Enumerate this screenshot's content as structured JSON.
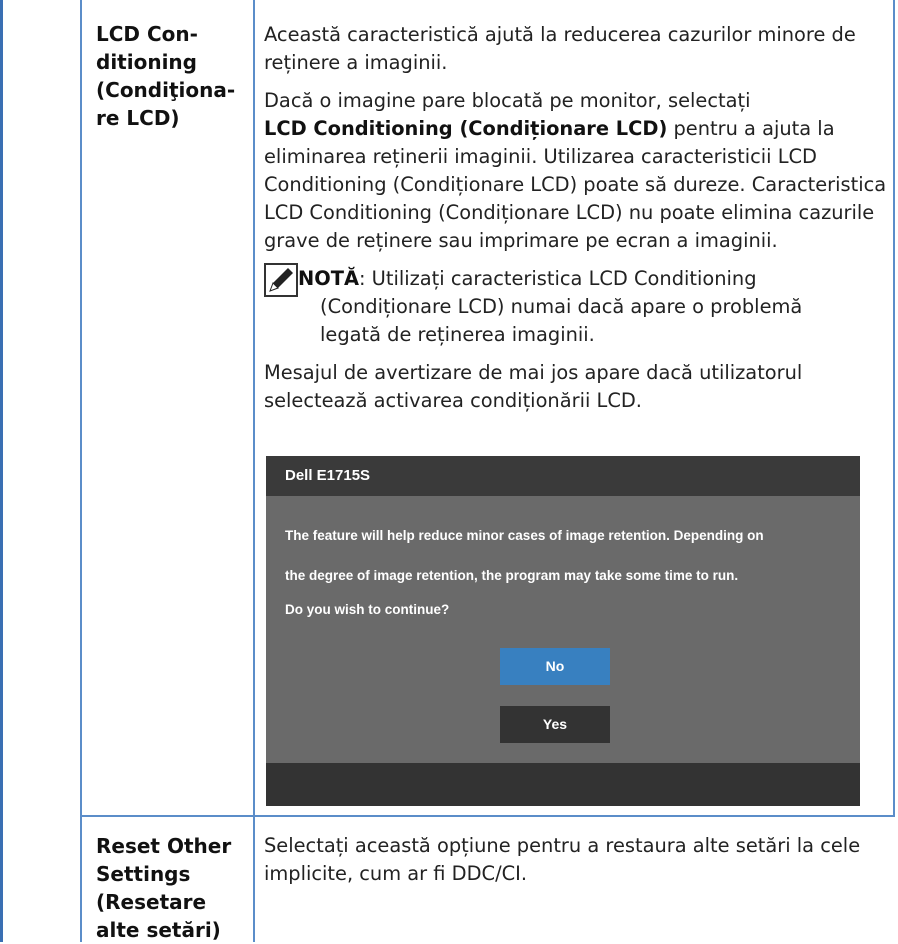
{
  "rows": [
    {
      "label_lines": [
        "LCD Con-",
        "ditioning",
        "(Condiţiona-",
        "re LCD)"
      ],
      "paragraphs": {
        "p1": "Această caracteristică ajută la reducerea cazurilor minore de reținere a imaginii.",
        "p2_before": "Dacă o imagine pare blocată pe monitor, selectați",
        "p2_bold": "LCD Conditioning (Condiționare LCD)",
        "p2_after": "pentru a ajuta la eliminarea reținerii imaginii. Utilizarea caracteristicii LCD Conditioning (Condiționare LCD) poate să dureze. Caracteristica LCD Conditioning (Condiționare LCD) nu poate elimina cazurile grave de reținere sau imprimare pe ecran a imaginii.",
        "note_label": "NOTĂ",
        "note_text_1": ": Utilizați caracteristica LCD Conditioning",
        "note_text_2": "(Condiționare LCD) numai dacă apare o problemă",
        "note_text_3": "legată de reținerea imaginii.",
        "p4": "Mesajul de avertizare de mai jos apare dacă utilizatorul selectează activarea condiționării LCD."
      }
    },
    {
      "label_lines": [
        "Reset Other",
        "Settings",
        "(Resetare",
        "alte setări)"
      ],
      "paragraphs": {
        "p1": "Selectați această opțiune pentru a restaura alte setări la cele implicite, cum ar fi DDC/CI."
      }
    }
  ],
  "osd": {
    "title": "Dell E1715S",
    "line1": "The feature will help reduce minor cases of image retention. Depending on",
    "line2": "the degree of image retention, the program may take some time to run.",
    "line3": "Do you wish to continue?",
    "no_label": "No",
    "yes_label": "Yes"
  },
  "icons": {
    "note": "pencil-note-icon"
  },
  "colors": {
    "rule": "#5b8dc9",
    "osd_bg": "#6a6a6a",
    "osd_dark": "#333333",
    "no_button": "#3880c0"
  }
}
